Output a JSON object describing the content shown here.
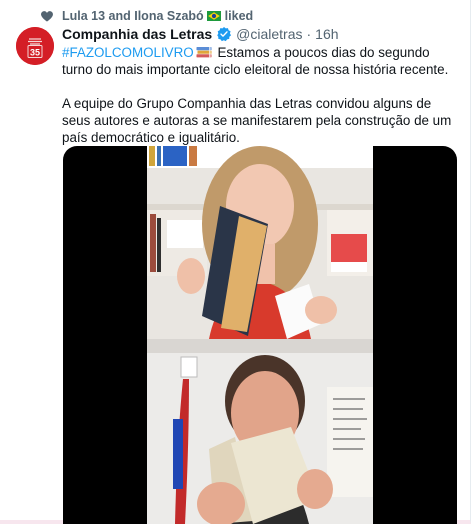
{
  "social_context": {
    "text": "Lula 13 and Ilona Szabó",
    "suffix": "liked",
    "icon": "heart-icon"
  },
  "tweet": {
    "author": {
      "name": "Companhia das Letras",
      "handle": "@cialetras",
      "separator": "·",
      "time": "16h",
      "verified": true,
      "avatar_text": "35"
    },
    "hashtag": "#FAZOLCOMOLIVRO",
    "line1_rest": "Estamos a poucos dias do segundo turno do mais importante ciclo eleitoral de nossa história recente.",
    "paragraph2": "A equipe do Grupo Companhia das Letras convidou alguns de seus autores e autoras a se manifestarem pela construção de um país democrático e igualitário.",
    "media": {
      "type": "video",
      "panels": 2
    }
  },
  "colors": {
    "accent": "#1d9bf0",
    "secondary_text": "#536471",
    "avatar_bg": "#d41e26",
    "media_bg": "#000000"
  }
}
